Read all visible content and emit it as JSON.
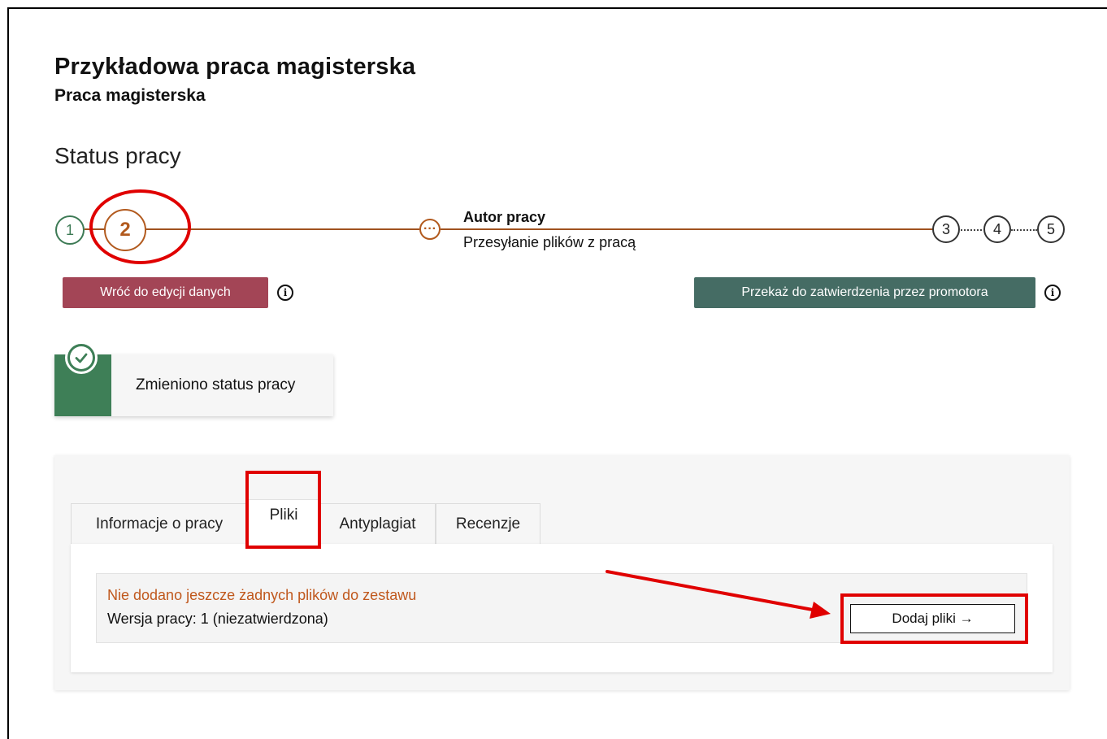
{
  "header": {
    "title": "Przykładowa praca magisterska",
    "subtitle": "Praca magisterska"
  },
  "status": {
    "heading": "Status pracy",
    "steps": [
      "1",
      "2",
      "3",
      "4",
      "5"
    ],
    "current_step_icon": "more-dots-icon",
    "current_step_dots": "···",
    "current_owner": "Autor pracy",
    "current_description": "Przesyłanie plików z pracą"
  },
  "actions": {
    "back_label": "Wróć do edycji danych",
    "forward_label": "Przekaż do zatwierdzenia przez promotora",
    "info_glyph": "i"
  },
  "toast": {
    "message": "Zmieniono status pracy"
  },
  "tabs": [
    {
      "label": "Informacje o pracy"
    },
    {
      "label": "Pliki"
    },
    {
      "label": "Antyplagiat"
    },
    {
      "label": "Recenzje"
    }
  ],
  "files": {
    "empty_message": "Nie dodano jeszcze żadnych plików do zestawu",
    "version_text": "Wersja pracy: 1 (niezatwierdzona)",
    "add_button_label": "Dodaj pliki →"
  },
  "colors": {
    "done": "#3d7a55",
    "current": "#b25a1e",
    "back_button": "#a34556",
    "forward_button": "#456c64",
    "annotation": "#e00000"
  }
}
